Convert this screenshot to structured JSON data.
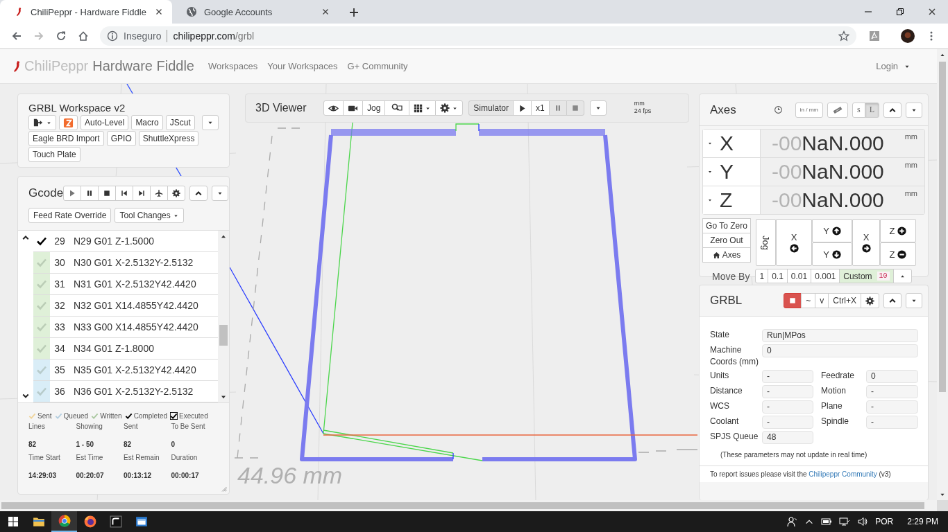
{
  "browser": {
    "tabs": [
      {
        "title": "ChiliPeppr - Hardware Fiddle",
        "selected": true,
        "kind": "chili"
      },
      {
        "title": "Google Accounts",
        "selected": false,
        "kind": "globe"
      }
    ],
    "security": "Inseguro",
    "url_host": "chilipeppr.com",
    "url_path": "/grbl"
  },
  "navbar": {
    "brand": "ChiliPeppr",
    "subtitle": "Hardware Fiddle",
    "links": [
      "Workspaces",
      "Your Workspaces",
      "G+ Community"
    ],
    "login": "Login"
  },
  "workspace": {
    "title": "GRBL Workspace v2",
    "buttons": [
      "Auto-Level",
      "Macro",
      "JScut",
      "Eagle BRD Import",
      "GPIO",
      "ShuttleXpress",
      "Touch Plate"
    ]
  },
  "gcode": {
    "title": "Gcode",
    "buttons": [
      "Feed Rate Override",
      "Tool Changes"
    ],
    "lines": [
      {
        "number": "29",
        "code": "N29 G01 Z-1.5000",
        "completed": true,
        "color": "#ffffff"
      },
      {
        "number": "30",
        "code": "N30 G01 X-2.5132Y-2.5132",
        "completed": false,
        "color": "#dff0d8"
      },
      {
        "number": "31",
        "code": "N31 G01 X-2.5132Y42.4420",
        "completed": false,
        "color": "#dff0d8"
      },
      {
        "number": "32",
        "code": "N32 G01 X14.4855Y42.4420",
        "completed": false,
        "color": "#dff0d8"
      },
      {
        "number": "33",
        "code": "N33 G00 X14.4855Y42.4420",
        "completed": false,
        "color": "#dff0d8"
      },
      {
        "number": "34",
        "code": "N34 G01 Z-1.8000",
        "completed": false,
        "color": "#dff0d8"
      },
      {
        "number": "35",
        "code": "N35 G01 X-2.5132Y42.4420",
        "completed": false,
        "color": "#d9edf7"
      },
      {
        "number": "36",
        "code": "N36 G01 X-2.5132Y-2.5132",
        "completed": false,
        "color": "#d9edf7"
      }
    ],
    "legend": [
      {
        "label": "Sent",
        "color": "#f0d49a",
        "boxed": false
      },
      {
        "label": "Queued",
        "color": "#b4cfe0",
        "boxed": false
      },
      {
        "label": "Written",
        "color": "#aac8a0",
        "boxed": false
      },
      {
        "label": "Completed",
        "color": "#000000",
        "boxed": false
      },
      {
        "label": "Executed",
        "color": "#000000",
        "boxed": true
      }
    ],
    "stats": [
      {
        "label": "Lines",
        "value": "82"
      },
      {
        "label": "Showing",
        "value": "1 - 50"
      },
      {
        "label": "Sent",
        "value": "82"
      },
      {
        "label": "To Be Sent",
        "value": "0"
      },
      {
        "label": "Time Start",
        "value": "14:29:03"
      },
      {
        "label": "Est Time",
        "value": "00:20:07"
      },
      {
        "label": "Est Remain",
        "value": "00:13:12"
      },
      {
        "label": "Duration",
        "value": "00:00:17"
      }
    ]
  },
  "viewer": {
    "title": "3D Viewer",
    "jog": "Jog",
    "simulator": "Simulator",
    "speed": "x1",
    "units": "mm",
    "fps": "24 fps",
    "measure": "44.96 mm"
  },
  "axes": {
    "title": "Axes",
    "units_toggle": "in / mm",
    "sizes": [
      {
        "label": "s",
        "selected": false
      },
      {
        "label": "L",
        "selected": true
      }
    ],
    "rows": [
      {
        "axis": "X",
        "prefix": "-00",
        "value": "NaN.000",
        "unit": "mm"
      },
      {
        "axis": "Y",
        "prefix": "-00",
        "value": "NaN.000",
        "unit": "mm"
      },
      {
        "axis": "Z",
        "prefix": "-00",
        "value": "NaN.000",
        "unit": "mm"
      }
    ],
    "zero_buttons": [
      "Go To Zero",
      "Zero Out",
      "Axes"
    ],
    "jog_label": "Jog",
    "jog_buttons": [
      {
        "axis": "X",
        "kind": "left"
      },
      {
        "axis": "Y",
        "kind": "up"
      },
      {
        "axis": "Y",
        "kind": "down"
      },
      {
        "axis": "X",
        "kind": "right"
      },
      {
        "axis": "Z",
        "kind": "plus"
      },
      {
        "axis": "Z",
        "kind": "minus"
      }
    ],
    "move_by": "Move By",
    "steps": [
      {
        "label": "1",
        "selected": false
      },
      {
        "label": "0.1",
        "selected": false
      },
      {
        "label": "0.01",
        "selected": false
      },
      {
        "label": "0.001",
        "selected": false
      },
      {
        "label": "Custom",
        "selected": true,
        "badge": "10"
      }
    ]
  },
  "grbl": {
    "title": "GRBL",
    "buttons": [
      "~",
      "v",
      "Ctrl+X"
    ],
    "fields": [
      {
        "label": "State",
        "value": "Run|MPos",
        "kind": "wide"
      },
      {
        "label": "Machine Coords (mm)",
        "value": "0",
        "kind": "wide"
      },
      {
        "label": "Units",
        "value": "-",
        "kind": "half"
      },
      {
        "label": "Feedrate",
        "value": "0",
        "kind": "half"
      },
      {
        "label": "Distance",
        "value": "-",
        "kind": "half"
      },
      {
        "label": "Motion",
        "value": "-",
        "kind": "half"
      },
      {
        "label": "WCS",
        "value": "-",
        "kind": "half"
      },
      {
        "label": "Plane",
        "value": "-",
        "kind": "half"
      },
      {
        "label": "Coolant",
        "value": "-",
        "kind": "half"
      },
      {
        "label": "Spindle",
        "value": "-",
        "kind": "half"
      },
      {
        "label": "SPJS Queue",
        "value": "48",
        "kind": "half"
      }
    ],
    "note": "(These parameters may not update in real time)",
    "footer": "To report issues please visit the",
    "footer_link": "Chilipeppr Community",
    "footer_suffix": "(v3)"
  },
  "taskbar": {
    "language": "POR",
    "time": "2:29 PM"
  }
}
